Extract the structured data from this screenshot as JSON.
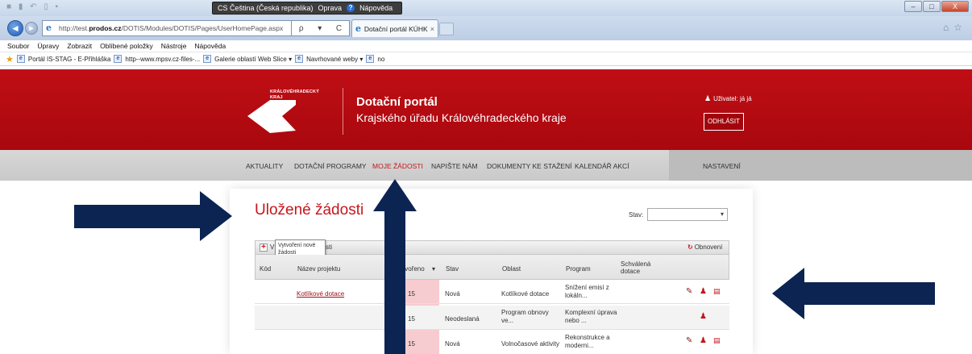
{
  "browser": {
    "ime_bar": {
      "text": "CS Čeština (Česká republika)",
      "repair": "Oprava",
      "help": "Nápověda"
    },
    "back_glyph": "◄",
    "forward_glyph": "►",
    "url": {
      "prefix": "http://test.",
      "domain": "prodos.cz",
      "path": "/DOTIS/Modules/DOTIS/Pages/UserHomePage.aspx"
    },
    "url_tools": {
      "search": "ρ",
      "dropdown": "▾",
      "refresh": "C"
    },
    "tab_title": "Dotační portál KÚHK",
    "tab_close": "×",
    "menu": [
      "Soubor",
      "Úpravy",
      "Zobrazit",
      "Oblíbené položky",
      "Nástroje",
      "Nápověda"
    ],
    "favorites": [
      {
        "label": "Portál IS-STAG - E-Přihláška"
      },
      {
        "label": "http--www.mpsv.cz-files-..."
      },
      {
        "label": "Galerie oblastí Web Slice ▾"
      },
      {
        "label": "Navrhované weby ▾"
      },
      {
        "label": "no"
      }
    ],
    "window_controls": {
      "minimize": "–",
      "maximize": "□",
      "close": "X"
    }
  },
  "header": {
    "logo_text_line1": "KRÁLOVÉHRADECKÝ",
    "logo_text_line2": "KRAJ",
    "title": "Dotační portál",
    "subtitle": "Krajského úřadu Královéhradeckého kraje",
    "user_label": "Uživatel: já já",
    "logout": "ODHLÁSIT"
  },
  "nav": {
    "items": [
      {
        "label": "AKTUALITY",
        "active": false
      },
      {
        "label": "DOTAČNÍ PROGRAMY",
        "active": false
      },
      {
        "label": "MOJE ŽÁDOSTI",
        "active": true
      },
      {
        "label": "NAPIŠTE NÁM",
        "active": false
      },
      {
        "label": "DOKUMENTY KE STAŽENÍ",
        "active": false
      },
      {
        "label": "KALENDÁŘ AKCÍ",
        "active": false
      }
    ],
    "settings": "NASTAVENÍ"
  },
  "content": {
    "title": "Uložené žádosti",
    "stav_label": "Stav:",
    "stav_value": "",
    "toolbar": {
      "add_partial_a": "V",
      "add_partial_b": "sti",
      "tooltip_line1": "Vytvoření nové",
      "tooltip_line2": "žádosti",
      "refresh": "Obnovení"
    },
    "columns": {
      "kod": "Kód",
      "nazev": "Název projektu",
      "vytvoreno": "ytvořeno",
      "stav": "Stav",
      "oblast": "Oblast",
      "program": "Program",
      "schvalena_1": "Schválená",
      "schvalena_2": "dotace"
    },
    "rows": [
      {
        "nazev": "Kotlíkové dotace",
        "vytvoreno": "15",
        "stav": "Nová",
        "oblast_1": "Kotlíkové dotace",
        "oblast_2": "",
        "program_1": "Snížení emisí z",
        "program_2": "lokáln..."
      },
      {
        "nazev": "",
        "vytvoreno": "15",
        "stav": "Neodeslaná",
        "oblast_1": "Program obnovy",
        "oblast_2": "ve...",
        "program_1": "Komplexní úprava",
        "program_2": "nebo ..."
      },
      {
        "nazev": "",
        "vytvoreno": "15",
        "stav": "Nová",
        "oblast_1": "Volnočasové aktivity",
        "oblast_2": "",
        "program_1": "Rekonstrukce a",
        "program_2": "moderni..."
      }
    ]
  },
  "icons": {
    "add": "+",
    "refresh": "↻",
    "sort": "▾",
    "edit": "✎",
    "user": "♟",
    "doc": "▤"
  },
  "colors": {
    "brand_red": "#c00e15",
    "arrow_navy": "#0c2451",
    "sorted_column": "#f6ccd0"
  }
}
